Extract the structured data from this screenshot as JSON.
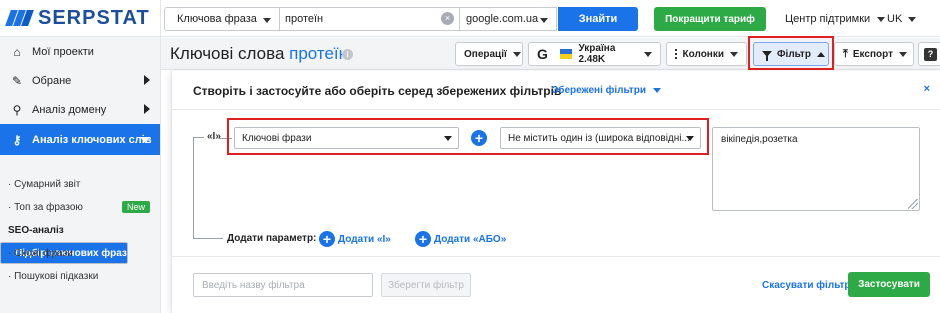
{
  "logo": {
    "text": "SERPSTAT"
  },
  "sidebar": {
    "items": [
      {
        "label": "Мої проекти",
        "icon": "home-icon",
        "glyph": "⌂"
      },
      {
        "label": "Обране",
        "icon": "pin-icon",
        "glyph": "✎"
      },
      {
        "label": "Аналіз домену",
        "icon": "domain-analysis-icon",
        "glyph": "⚲"
      },
      {
        "label": "Аналіз ключових слів",
        "icon": "key-icon",
        "glyph": "⚷"
      }
    ],
    "sub_items": [
      {
        "label": "· Сумарний звіт"
      },
      {
        "label": "· Топ за фразою",
        "badge": "New"
      },
      {
        "label": "SEO-аналіз"
      },
      {
        "label": "Підбір ключових фраз"
      },
      {
        "label": "· Схожі фрази"
      },
      {
        "label": "· Пошукові підказки"
      }
    ]
  },
  "topbar": {
    "search_type": "Ключова фраза",
    "search_value": "протеїн",
    "clear_glyph": "×",
    "database": "google.com.ua",
    "find_button": "Знайти",
    "upgrade_button": "Покращити тариф",
    "support": "Центр підтримки",
    "language": "UK"
  },
  "header": {
    "title": "Ключові слова",
    "keyword": "протеїн",
    "info_glyph": "i",
    "operations": "Операції",
    "google_letter": "G",
    "country": "Україна 2.48K",
    "columns": "Колонки",
    "filter": "Фільтр",
    "export": "Експорт",
    "export_glyph": "⤒",
    "help_glyph": "?"
  },
  "filter_panel": {
    "title": "Створіть і застосуйте або оберіть серед збережених фільтрів",
    "saved_filters": "Збережені фільтри",
    "close_glyph": "×",
    "group_operator": "«І»",
    "condition": {
      "field": "Ключові фрази",
      "operator": "Не містить один із (широка відповідні...",
      "value": "вікіпедія,розетка"
    },
    "plus_glyph": "+",
    "add_param_label": "Додати параметр:",
    "add_and": "Додати «І»",
    "add_or": "Додати «АБО»",
    "filter_name_placeholder": "Введіть назву фільтра",
    "save_filter": "Зберегти фільтр",
    "cancel_filter": "Скасувати фільтр",
    "apply": "Застосувати"
  },
  "colors": {
    "accent": "#1a73e8",
    "success": "#2daa45",
    "highlight": "#e02020"
  }
}
